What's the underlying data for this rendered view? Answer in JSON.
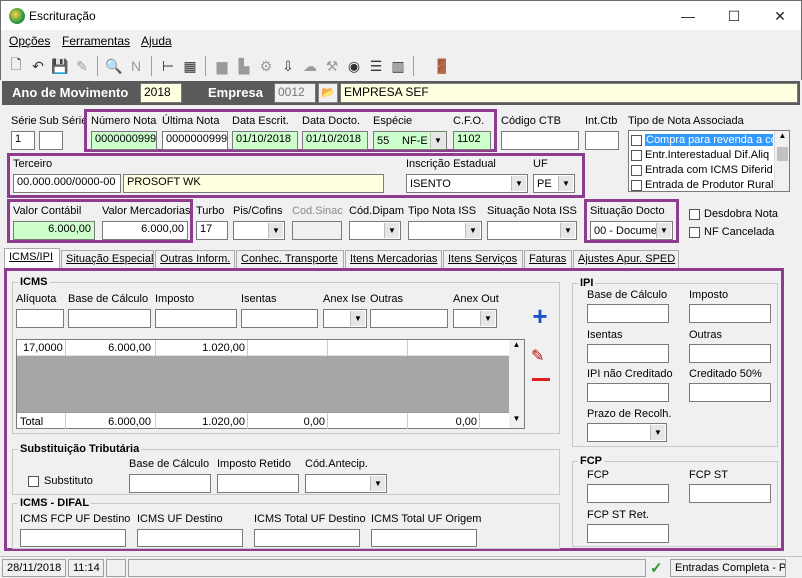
{
  "window": {
    "title": "Escrituração",
    "min": "—",
    "max": "☐",
    "close": "✕"
  },
  "menu": [
    "Opções",
    "Ferramentas",
    "Ajuda"
  ],
  "header": {
    "ano_label": "Ano de Movimento",
    "ano": "2018",
    "empresa_label": "Empresa",
    "empresa_code": "0012",
    "empresa_name": "EMPRESA SEF"
  },
  "doc": {
    "serie_label": "Série",
    "serie": "1",
    "subserie_label": "Sub Série",
    "subserie": "",
    "numero_label": "Número Nota",
    "numero": "0000000999",
    "ultima_label": "Última Nota",
    "ultima": "0000000999",
    "data_escrit_label": "Data Escrit.",
    "data_escrit": "01/10/2018",
    "data_docto_label": "Data Docto.",
    "data_docto": "01/10/2018",
    "especie_label": "Espécie",
    "especie_code": "55",
    "especie": "NF-E",
    "cfo_label": "C.F.O.",
    "cfo": "1102",
    "codctb_label": "Código CTB",
    "codctb": "",
    "intctb_label": "Int.Ctb",
    "intctb": "",
    "tipo_nota_label": "Tipo de Nota Associada",
    "tipo_nota_items": [
      "Compra para revenda a co",
      "Entr.Interestadual Dif.Aliq",
      "Entrada com ICMS Diferido",
      "Entrada de Produtor Rural"
    ]
  },
  "terceiro": {
    "label": "Terceiro",
    "code": "00.000.000/0000-00",
    "name": "PROSOFT WK",
    "ie_label": "Inscrição Estadual",
    "ie": "ISENTO",
    "uf_label": "UF",
    "uf": "PE"
  },
  "valores": {
    "contabil_label": "Valor Contábil",
    "contabil": "6.000,00",
    "mercadorias_label": "Valor Mercadorias",
    "mercadorias": "6.000,00",
    "turbo_label": "Turbo",
    "turbo": "17",
    "piscofins_label": "Pis/Cofins",
    "codsinac_label": "Cod.Sinac",
    "coddipam_label": "Cód.Dipam",
    "tiponotaiss_label": "Tipo Nota ISS",
    "situacaoiss_label": "Situação Nota ISS",
    "situacao_label": "Situação Docto",
    "situacao": "00 - Documen",
    "desdobra_label": "Desdobra Nota",
    "cancelada_label": "NF Cancelada"
  },
  "tabs": [
    "ICMS/IPI",
    "Situação Especial",
    "Outras Inform.",
    "Conhec. Transporte",
    "Itens Mercadorias",
    "Itens Serviços",
    "Faturas",
    "Ajustes Apur. SPED"
  ],
  "icms": {
    "title": "ICMS",
    "cols": [
      "Alíquota",
      "Base de Cálculo",
      "Imposto",
      "Isentas",
      "Anex Ise",
      "Outras",
      "Anex Out"
    ],
    "row": [
      "17,0000",
      "6.000,00",
      "1.020,00",
      "",
      "",
      "",
      ""
    ],
    "total_label": "Total",
    "total": [
      "6.000,00",
      "1.020,00",
      "0,00",
      "0,00",
      "0,00"
    ]
  },
  "st": {
    "title": "Substituição Tributária",
    "substituto_label": "Substituto",
    "base_label": "Base de Cálculo",
    "retido_label": "Imposto Retido",
    "codantecip_label": "Cód.Antecip."
  },
  "difal": {
    "title": "ICMS - DIFAL",
    "fcp_label": "ICMS FCP UF Destino",
    "uf_destino_label": "ICMS UF Destino",
    "total_destino_label": "ICMS Total UF Destino",
    "total_origem_label": "ICMS Total UF Origem"
  },
  "ipi": {
    "title": "IPI",
    "base_label": "Base de Cálculo",
    "imposto_label": "Imposto",
    "isentas_label": "Isentas",
    "outras_label": "Outras",
    "nao_cred_label": "IPI não Creditado",
    "cred50_label": "Creditado 50%",
    "prazo_label": "Prazo de Recolh."
  },
  "fcp": {
    "title": "FCP",
    "fcp_label": "FCP",
    "fcpst_label": "FCP ST",
    "fcpstret_label": "FCP ST Ret."
  },
  "status": {
    "date": "28/11/2018",
    "time": "11:14",
    "mode": "Entradas Completa - P"
  },
  "colors": {
    "highlight": "#8e3c8e",
    "header_bar": "#5a5a5a",
    "selected_item": "#3399ff"
  }
}
